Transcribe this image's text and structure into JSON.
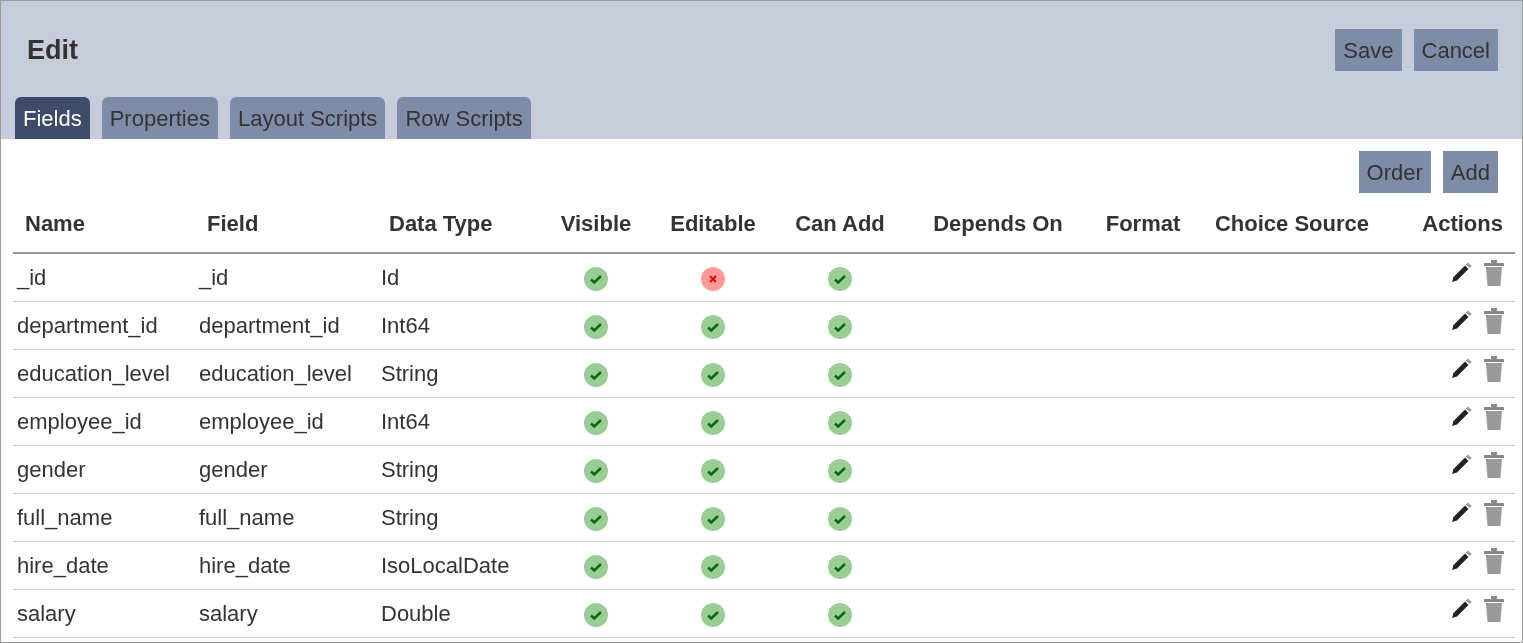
{
  "header": {
    "title": "Edit",
    "buttons": [
      "Save",
      "Cancel"
    ]
  },
  "tabs": [
    {
      "label": "Fields",
      "selected": true
    },
    {
      "label": "Properties",
      "selected": false
    },
    {
      "label": "Layout Scripts",
      "selected": false
    },
    {
      "label": "Row Scripts",
      "selected": false
    }
  ],
  "toolbar": {
    "buttons": [
      "Order",
      "Add"
    ]
  },
  "table": {
    "columns": [
      "Name",
      "Field",
      "Data Type",
      "Visible",
      "Editable",
      "Can Add",
      "Depends On",
      "Format",
      "Choice Source",
      "Actions"
    ],
    "rows": [
      {
        "name": "_id",
        "field": "_id",
        "data_type": "Id",
        "visible": true,
        "editable": false,
        "can_add": true
      },
      {
        "name": "department_id",
        "field": "department_id",
        "data_type": "Int64",
        "visible": true,
        "editable": true,
        "can_add": true
      },
      {
        "name": "education_level",
        "field": "education_level",
        "data_type": "String",
        "visible": true,
        "editable": true,
        "can_add": true
      },
      {
        "name": "employee_id",
        "field": "employee_id",
        "data_type": "Int64",
        "visible": true,
        "editable": true,
        "can_add": true
      },
      {
        "name": "gender",
        "field": "gender",
        "data_type": "String",
        "visible": true,
        "editable": true,
        "can_add": true
      },
      {
        "name": "full_name",
        "field": "full_name",
        "data_type": "String",
        "visible": true,
        "editable": true,
        "can_add": true
      },
      {
        "name": "hire_date",
        "field": "hire_date",
        "data_type": "IsoLocalDate",
        "visible": true,
        "editable": true,
        "can_add": true
      },
      {
        "name": "salary",
        "field": "salary",
        "data_type": "Double",
        "visible": true,
        "editable": true,
        "can_add": true
      }
    ]
  }
}
